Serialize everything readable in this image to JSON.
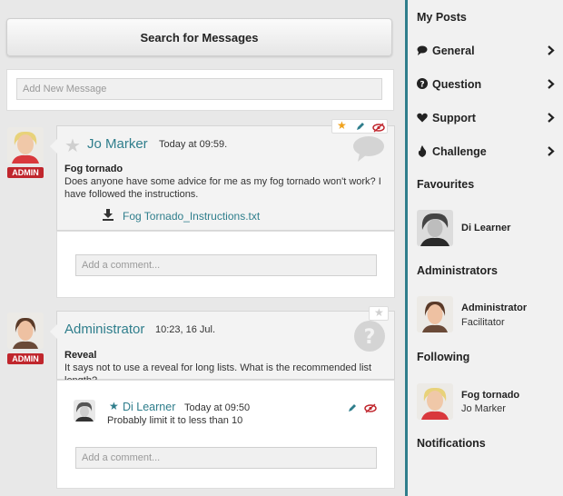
{
  "search": {
    "button_label": "Search for Messages"
  },
  "add_message": {
    "placeholder": "Add New Message"
  },
  "posts": [
    {
      "badge": "ADMIN",
      "author": "Jo Marker",
      "time": "Today at 09:59.",
      "title": "Fog tornado",
      "body": "Does anyone have some advice for me as my fog tornado won't work? I have followed the instructions.",
      "attachment": "Fog Tornado_Instructions.txt",
      "comment_placeholder": "Add a comment..."
    },
    {
      "badge": "ADMIN",
      "author": "Administrator",
      "time": "10:23, 16 Jul.",
      "title": "Reveal",
      "body": "It says not to use a reveal for long lists. What is the recommended list length?",
      "reply": {
        "author": "Di Learner",
        "time": "Today at 09:50",
        "text": "Probably limit it to less than 10"
      },
      "comment_placeholder": "Add a comment..."
    }
  ],
  "sidebar": {
    "my_posts": "My Posts",
    "categories": [
      {
        "label": "General",
        "icon": "comment-icon"
      },
      {
        "label": "Question",
        "icon": "question-icon"
      },
      {
        "label": "Support",
        "icon": "heart-icon"
      },
      {
        "label": "Challenge",
        "icon": "flame-icon"
      }
    ],
    "favourites": {
      "heading": "Favourites",
      "name": "Di Learner"
    },
    "administrators": {
      "heading": "Administrators",
      "name": "Administrator",
      "role": "Facilitator"
    },
    "following": {
      "heading": "Following",
      "title": "Fog tornado",
      "name": "Jo Marker"
    },
    "notifications": "Notifications"
  },
  "colors": {
    "accent": "#2f7e8c",
    "badge": "#c0262d",
    "star": "#f0a21c"
  }
}
